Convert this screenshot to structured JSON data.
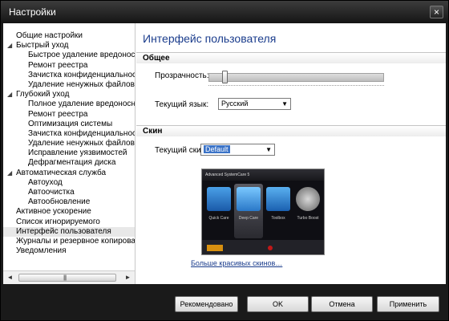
{
  "window": {
    "title": "Настройки"
  },
  "sidebar": {
    "items": [
      {
        "label": "Общие настройки",
        "level": 0,
        "expander": ""
      },
      {
        "label": "Быстрый уход",
        "level": 0,
        "expander": "◢"
      },
      {
        "label": "Быстрое удаление вредоносного П",
        "level": 1,
        "expander": ""
      },
      {
        "label": "Ремонт реестра",
        "level": 1,
        "expander": ""
      },
      {
        "label": "Зачистка конфиденциальности",
        "level": 1,
        "expander": ""
      },
      {
        "label": "Удаление ненужных файлов",
        "level": 1,
        "expander": ""
      },
      {
        "label": "Глубокий уход",
        "level": 0,
        "expander": "◢"
      },
      {
        "label": "Полное удаление вредоносного ПС",
        "level": 1,
        "expander": ""
      },
      {
        "label": "Ремонт реестра",
        "level": 1,
        "expander": ""
      },
      {
        "label": "Оптимизация системы",
        "level": 1,
        "expander": ""
      },
      {
        "label": "Зачистка конфиденциальности",
        "level": 1,
        "expander": ""
      },
      {
        "label": "Удаление ненужных файлов",
        "level": 1,
        "expander": ""
      },
      {
        "label": "Исправление уязвимостей",
        "level": 1,
        "expander": ""
      },
      {
        "label": "Дефрагментация диска",
        "level": 1,
        "expander": ""
      },
      {
        "label": "Автоматическая служба",
        "level": 0,
        "expander": "◢"
      },
      {
        "label": "Автоуход",
        "level": 1,
        "expander": ""
      },
      {
        "label": "Автоочистка",
        "level": 1,
        "expander": ""
      },
      {
        "label": "Автообновление",
        "level": 1,
        "expander": ""
      },
      {
        "label": "Активное ускорение",
        "level": 0,
        "expander": ""
      },
      {
        "label": "Список игнорируемого",
        "level": 0,
        "expander": ""
      },
      {
        "label": "Интерфейс пользователя",
        "level": 0,
        "expander": "",
        "selected": true
      },
      {
        "label": "Журналы и резервное копирование",
        "level": 0,
        "expander": ""
      },
      {
        "label": "Уведомления",
        "level": 0,
        "expander": ""
      }
    ],
    "scroll_left_icon": "◄",
    "scroll_right_icon": "►",
    "scroll_grip": "||||"
  },
  "main": {
    "title": "Интерфейс пользователя",
    "general": {
      "heading": "Общее",
      "opacity_label": "Прозрачность:",
      "opacity_value": 0.08,
      "language_label": "Текущий язык:",
      "language_value": "Русский"
    },
    "skin": {
      "heading": "Скин",
      "skin_label": "Текущий скин:",
      "skin_value": "Default",
      "preview": {
        "app_title": "Advanced SystemCare 5",
        "tiles": [
          "Quick Care",
          "Deep Care",
          "Toolbox",
          "Turbo Boost"
        ]
      },
      "more_link": "Больше красивых скинов…"
    }
  },
  "buttons": {
    "recommended": "Рекомендовано",
    "ok": "OK",
    "cancel": "Отмена",
    "apply": "Применить"
  },
  "icons": {
    "close": "×",
    "dropdown": "▼"
  }
}
